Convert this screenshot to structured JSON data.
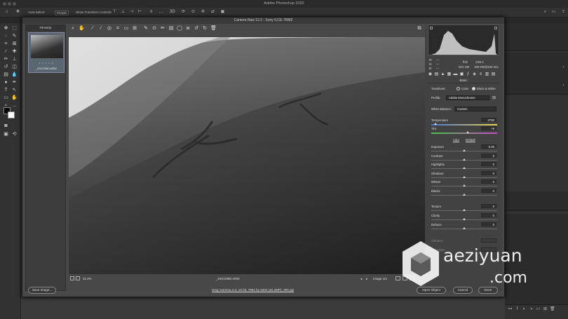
{
  "app": {
    "title": "Adobe Photoshop 2020"
  },
  "options_bar": {
    "auto_select_label": "Auto-Select:",
    "auto_select_value": "People",
    "show_transform_label": "Show Transform Controls"
  },
  "dialog": {
    "title": "Camera Raw 12.2  -  Sony ILCE-7RM2",
    "filmstrip": {
      "header": "Filmstrip",
      "thumb_rating": "• • • • •",
      "thumb_filename": "_DSC0380.ARW"
    },
    "readout": {
      "r_label": "R:",
      "g_label": "G:",
      "b_label": "B:",
      "r_val": "---",
      "g_val": "---",
      "b_val": "---",
      "aperture": "f/22",
      "shutter": "1/25 s",
      "iso": "ISO 100",
      "lens": "100-400@100 mm"
    },
    "basic": {
      "panel_title": "Basic",
      "treatment_label": "Treatment:",
      "treatment_color": "Color",
      "treatment_bw": "Black & White",
      "profile_label": "Profile:",
      "profile_value": "Adobe Monochrome",
      "white_balance_label": "White Balance:",
      "white_balance_value": "Custom",
      "auto_link": "Auto",
      "default_link": "Default",
      "sliders": [
        {
          "name": "Temperature",
          "value": "2750",
          "level": 0.06
        },
        {
          "name": "Tint",
          "value": "+9",
          "level": 0.55
        },
        {
          "name": "Exposure",
          "value": "0.00",
          "level": 0.5
        },
        {
          "name": "Contrast",
          "value": "0",
          "level": 0.5
        },
        {
          "name": "Highlights",
          "value": "0",
          "level": 0.5
        },
        {
          "name": "Shadows",
          "value": "0",
          "level": 0.5
        },
        {
          "name": "Whites",
          "value": "0",
          "level": 0.5
        },
        {
          "name": "Blacks",
          "value": "0",
          "level": 0.5
        },
        {
          "name": "Texture",
          "value": "0",
          "level": 0.5
        },
        {
          "name": "Clarity",
          "value": "0",
          "level": 0.5
        },
        {
          "name": "Dehaze",
          "value": "0",
          "level": 0.5
        }
      ],
      "vibrance_label": "Vibrance",
      "saturation_label": "Saturation"
    },
    "status": {
      "zoom": "31.9%",
      "filename": "_DSC0380.ARW",
      "image_count": "Image 1/1"
    },
    "buttons": {
      "save_image": "Save Image...",
      "open_object": "Open Object",
      "cancel": "Cancel",
      "done": "Done"
    },
    "workflow_link": "Gray Gamma 2.2; 16 bit; 7952 by 5304 (42.2MP); 300 ppi"
  },
  "watermark": {
    "text": "aeziyuan",
    "suffix": ".com"
  },
  "colors": {
    "dialog_bg": "#484848",
    "panel_bg": "#424242",
    "accent_blue": "#8aa6d6"
  }
}
